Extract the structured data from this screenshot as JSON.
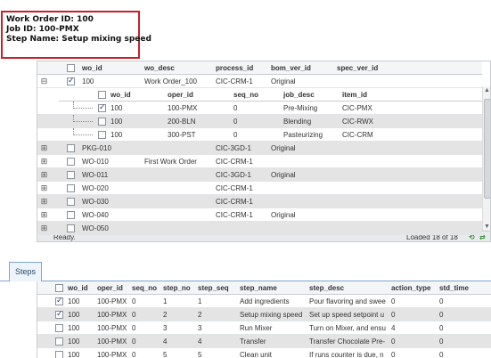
{
  "info": {
    "work_order": "Work Order ID: 100",
    "job": "Job ID: 100-PMX",
    "step": "Step Name: Setup mixing speed"
  },
  "work_orders": {
    "columns": [
      "wo_id",
      "wo_desc",
      "process_id",
      "bom_ver_id",
      "spec_ver_id"
    ],
    "rows": [
      {
        "wo_id": "100",
        "wo_desc": "Work Order_100",
        "process_id": "CIC-CRM-1",
        "bom_ver_id": "Original",
        "spec_ver_id": "",
        "checked": true,
        "expanded": true
      },
      {
        "wo_id": "PKG-010",
        "wo_desc": "",
        "process_id": "CIC-3GD-1",
        "bom_ver_id": "Original",
        "spec_ver_id": "",
        "checked": false,
        "expanded": false
      },
      {
        "wo_id": "WO-010",
        "wo_desc": "First Work Order",
        "process_id": "CIC-CRM-1",
        "bom_ver_id": "",
        "spec_ver_id": "",
        "checked": false,
        "expanded": false
      },
      {
        "wo_id": "WO-011",
        "wo_desc": "",
        "process_id": "CIC-3GD-1",
        "bom_ver_id": "Original",
        "spec_ver_id": "",
        "checked": false,
        "expanded": false
      },
      {
        "wo_id": "WO-020",
        "wo_desc": "",
        "process_id": "CIC-CRM-1",
        "bom_ver_id": "",
        "spec_ver_id": "",
        "checked": false,
        "expanded": false
      },
      {
        "wo_id": "WO-030",
        "wo_desc": "",
        "process_id": "CIC-CRM-1",
        "bom_ver_id": "",
        "spec_ver_id": "",
        "checked": false,
        "expanded": false
      },
      {
        "wo_id": "WO-040",
        "wo_desc": "",
        "process_id": "CIC-CRM-1",
        "bom_ver_id": "Original",
        "spec_ver_id": "",
        "checked": false,
        "expanded": false
      },
      {
        "wo_id": "WO-050",
        "wo_desc": "",
        "process_id": "",
        "bom_ver_id": "",
        "spec_ver_id": "",
        "checked": false,
        "expanded": false
      }
    ],
    "jobs": {
      "columns": [
        "wo_id",
        "oper_id",
        "seq_no",
        "job_desc",
        "item_id"
      ],
      "rows": [
        {
          "wo_id": "100",
          "oper_id": "100-PMX",
          "seq_no": "0",
          "job_desc": "Pre-Mixing",
          "item_id": "CIC-PMX",
          "checked": true
        },
        {
          "wo_id": "100",
          "oper_id": "200-BLN",
          "seq_no": "0",
          "job_desc": "Blending",
          "item_id": "CIC-RWX",
          "checked": false
        },
        {
          "wo_id": "100",
          "oper_id": "300-PST",
          "seq_no": "0",
          "job_desc": "Pasteurizing",
          "item_id": "CIC-CRM",
          "checked": false
        }
      ]
    },
    "status": "Ready.",
    "loaded": "Loaded 18 of 18"
  },
  "steps": {
    "tab_label": "Steps",
    "columns": [
      "wo_id",
      "oper_id",
      "seq_no",
      "step_no",
      "step_seq",
      "step_name",
      "step_desc",
      "action_type",
      "std_time"
    ],
    "rows": [
      {
        "wo_id": "100",
        "oper_id": "100-PMX",
        "seq_no": "0",
        "step_no": "1",
        "step_seq": "1",
        "step_name": "Add ingredients",
        "step_desc": "Pour flavoring and swee",
        "action_type": "0",
        "std_time": "0",
        "checked": true
      },
      {
        "wo_id": "100",
        "oper_id": "100-PMX",
        "seq_no": "0",
        "step_no": "2",
        "step_seq": "2",
        "step_name": "Setup mixing speed",
        "step_desc": "Set up speed setpoint u",
        "action_type": "0",
        "std_time": "0",
        "checked": true
      },
      {
        "wo_id": "100",
        "oper_id": "100-PMX",
        "seq_no": "0",
        "step_no": "3",
        "step_seq": "3",
        "step_name": "Run Mixer",
        "step_desc": "Turn on Mixer, and ensu",
        "action_type": "4",
        "std_time": "0",
        "checked": false
      },
      {
        "wo_id": "100",
        "oper_id": "100-PMX",
        "seq_no": "0",
        "step_no": "4",
        "step_seq": "4",
        "step_name": "Transfer",
        "step_desc": "Transfer Chocolate Pre-",
        "action_type": "0",
        "std_time": "0",
        "checked": false
      },
      {
        "wo_id": "100",
        "oper_id": "100-PMX",
        "seq_no": "0",
        "step_no": "5",
        "step_seq": "5",
        "step_name": "Clean unit",
        "step_desc": "If runs counter is due, n",
        "action_type": "0",
        "std_time": "0",
        "checked": false
      }
    ]
  }
}
